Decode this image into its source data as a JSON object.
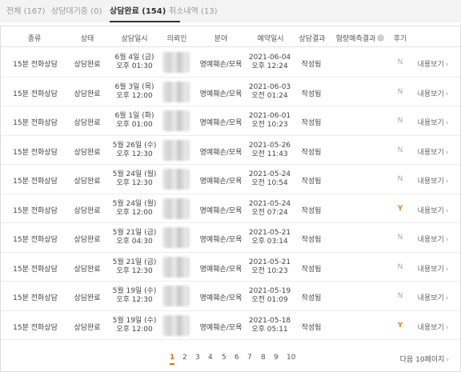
{
  "tabs": [
    {
      "label": "전체 (167)"
    },
    {
      "label": "상담대기중 (0)"
    },
    {
      "label": "상담완료 (154)"
    },
    {
      "label": "취소내역 (13)"
    }
  ],
  "columns": {
    "type": "종류",
    "status": "상태",
    "datetime": "상담일시",
    "client": "의뢰인",
    "field": "분야",
    "reserved": "예약일시",
    "result": "상담결과",
    "prediction": "형량예측결과",
    "review": "후기"
  },
  "rows": [
    {
      "type": "15분 전화상담",
      "status": "상담완료",
      "date": "6월 4일 (금)",
      "time": "오후 01:30",
      "field": "명예훼손/모욕",
      "res_date": "2021-06-04",
      "res_time": "오후 12:24",
      "result": "작성됨",
      "review": "N",
      "view": "내용보기"
    },
    {
      "type": "15분 전화상담",
      "status": "상담완료",
      "date": "6월 3일 (목)",
      "time": "오후 12:00",
      "field": "명예훼손/모욕",
      "res_date": "2021-06-03",
      "res_time": "오전 01:24",
      "result": "작성됨",
      "review": "N",
      "view": "내용보기"
    },
    {
      "type": "15분 전화상담",
      "status": "상담완료",
      "date": "6월 1일 (화)",
      "time": "오후 01:00",
      "field": "명예훼손/모욕",
      "res_date": "2021-06-01",
      "res_time": "오전 10:23",
      "result": "작성됨",
      "review": "N",
      "view": "내용보기"
    },
    {
      "type": "15분 전화상담",
      "status": "상담완료",
      "date": "5월 26일 (수)",
      "time": "오후 12:30",
      "field": "명예훼손/모욕",
      "res_date": "2021-05-26",
      "res_time": "오전 11:43",
      "result": "작성됨",
      "review": "N",
      "view": "내용보기"
    },
    {
      "type": "15분 전화상담",
      "status": "상담완료",
      "date": "5월 24일 (월)",
      "time": "오후 12:30",
      "field": "명예훼손/모욕",
      "res_date": "2021-05-24",
      "res_time": "오전 10:54",
      "result": "작성됨",
      "review": "N",
      "view": "내용보기"
    },
    {
      "type": "15분 전화상담",
      "status": "상담완료",
      "date": "5월 24일 (월)",
      "time": "오후 12:00",
      "field": "명예훼손/모욕",
      "res_date": "2021-05-24",
      "res_time": "오전 07:24",
      "result": "작성됨",
      "review": "Y",
      "view": "내용보기"
    },
    {
      "type": "15분 전화상담",
      "status": "상담완료",
      "date": "5월 21일 (금)",
      "time": "오후 04:30",
      "field": "명예훼손/모욕",
      "res_date": "2021-05-21",
      "res_time": "오후 03:14",
      "result": "작성됨",
      "review": "N",
      "view": "내용보기"
    },
    {
      "type": "15분 전화상담",
      "status": "상담완료",
      "date": "5월 21일 (금)",
      "time": "오후 12:30",
      "field": "명예훼손/모욕",
      "res_date": "2021-05-21",
      "res_time": "오전 10:23",
      "result": "작성됨",
      "review": "N",
      "view": "내용보기"
    },
    {
      "type": "15분 전화상담",
      "status": "상담완료",
      "date": "5월 19일 (수)",
      "time": "오후 12:30",
      "field": "명예훼손/모욕",
      "res_date": "2021-05-19",
      "res_time": "오전 01:09",
      "result": "작성됨",
      "review": "N",
      "view": "내용보기"
    },
    {
      "type": "15분 전화상담",
      "status": "상담완료",
      "date": "5월 19일 (수)",
      "time": "오후 12:00",
      "field": "명예훼손/모욕",
      "res_date": "2021-05-18",
      "res_time": "오후 05:11",
      "result": "작성됨",
      "review": "Y",
      "view": "내용보기"
    }
  ],
  "pagination": {
    "pages": [
      "1",
      "2",
      "3",
      "4",
      "5",
      "6",
      "7",
      "8",
      "9",
      "10"
    ],
    "current": "1",
    "next_label": "다음 10페이지"
  },
  "icons": {
    "view_chevron": "chevron-right-icon",
    "next_chevron": "chevron-right-icon",
    "help": "help-circle-icon"
  },
  "colors": {
    "accent": "#e36b10",
    "review_yes": "#f07c1b",
    "review_no": "#aaaaaa",
    "tab_bar": "#f3f3f3"
  }
}
